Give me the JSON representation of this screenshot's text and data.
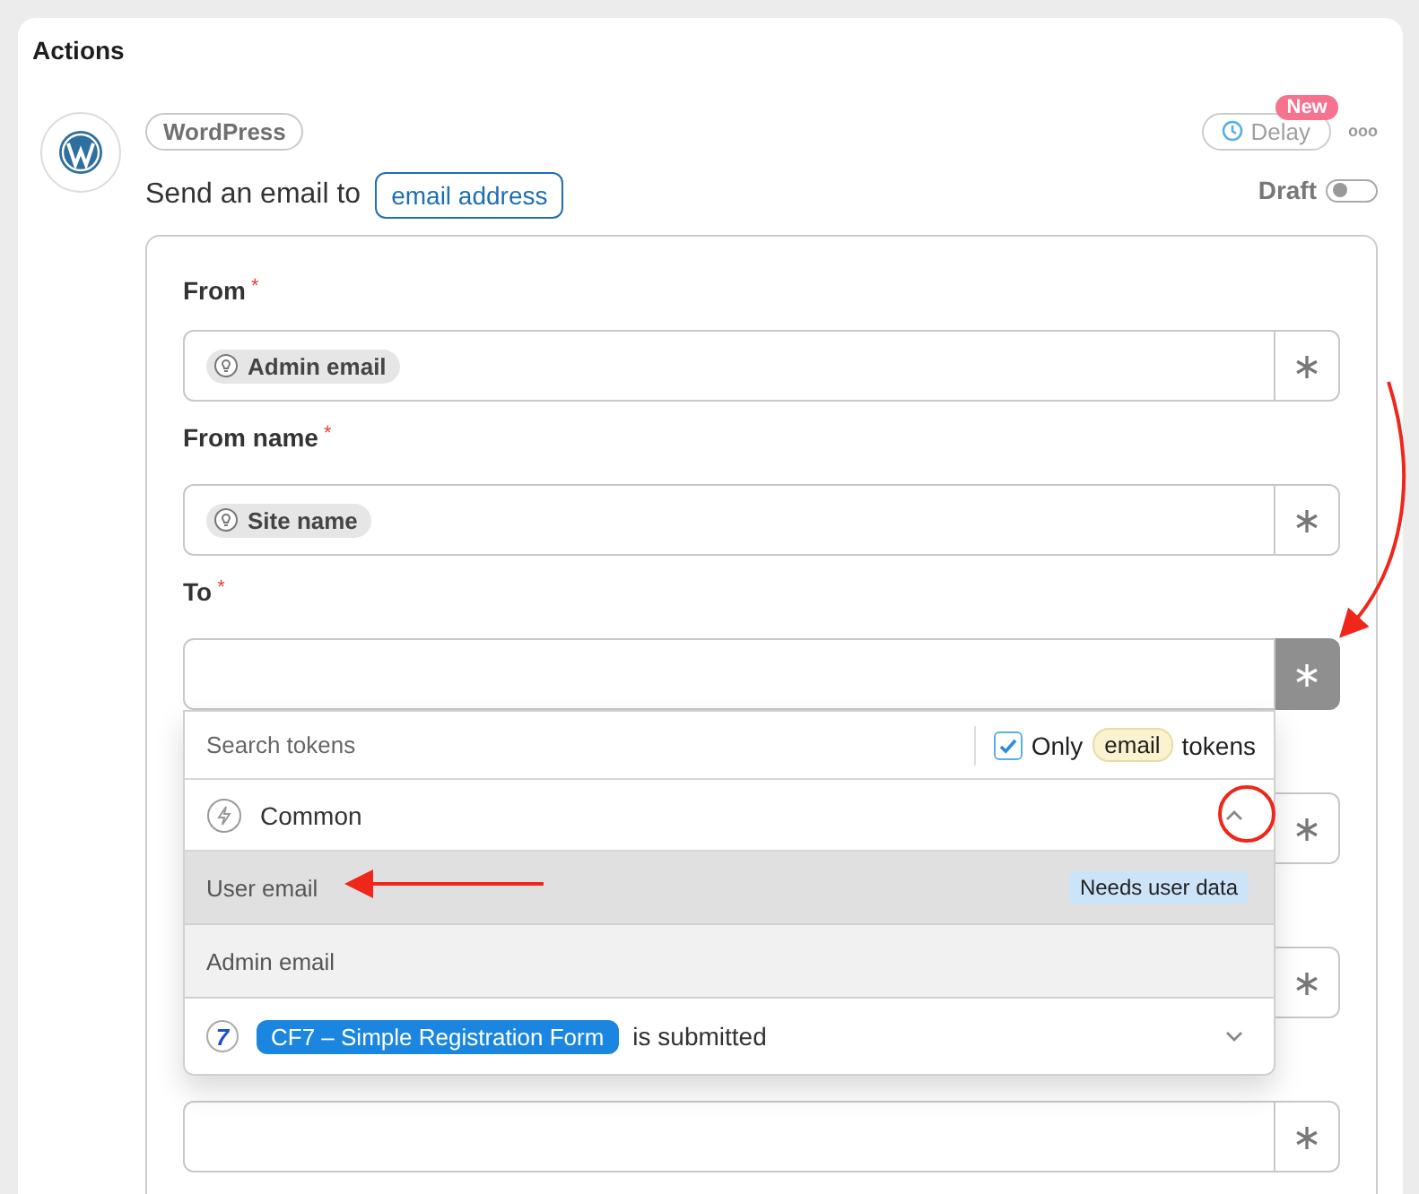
{
  "section": {
    "title": "Actions"
  },
  "action": {
    "integration": "WordPress",
    "sentence": "Send an email to",
    "target_chip": "email address",
    "delay": {
      "label": "Delay",
      "badge": "New"
    },
    "more": "ooo",
    "draft": {
      "label": "Draft",
      "on": false
    }
  },
  "fields": [
    {
      "label": "From",
      "required_mark": "*",
      "token": "Admin email",
      "button": "∗",
      "active": false
    },
    {
      "label": "From name",
      "required_mark": "*",
      "token": "Site name",
      "button": "∗",
      "active": false
    },
    {
      "label": "To",
      "required_mark": "*",
      "button": "∗",
      "active": true
    },
    {
      "button": "∗",
      "active": false
    },
    {
      "button": "∗",
      "active": false
    },
    {
      "button": "∗",
      "active": false
    }
  ],
  "dropdown": {
    "search": {
      "placeholder": "Search tokens"
    },
    "filter": {
      "checked": true,
      "before": "Only",
      "chip": "email",
      "after": "tokens"
    },
    "groups": [
      {
        "kind": "common",
        "label": "Common",
        "expanded": true,
        "items": [
          {
            "label": "User email",
            "selected": true,
            "badge": "Needs user data"
          },
          {
            "label": "Admin email",
            "selected": false
          }
        ]
      },
      {
        "kind": "form",
        "icon_text": "7",
        "chip": "CF7 – Simple Registration Form",
        "label": "is submitted",
        "expanded": false
      }
    ]
  }
}
